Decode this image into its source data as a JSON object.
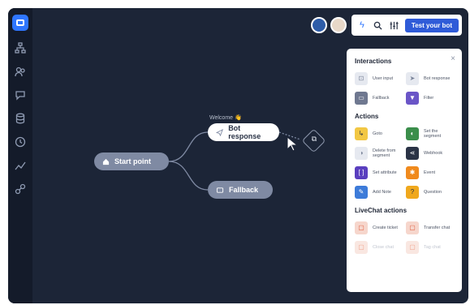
{
  "sidebar": {
    "items": [
      {
        "icon": "chat-bubble-icon"
      },
      {
        "icon": "flow-tree-icon"
      },
      {
        "icon": "users-icon"
      },
      {
        "icon": "message-icon"
      },
      {
        "icon": "database-icon"
      },
      {
        "icon": "clock-icon"
      },
      {
        "icon": "analytics-icon"
      },
      {
        "icon": "integrations-icon"
      }
    ]
  },
  "flow": {
    "start_label": "Start point",
    "welcome_label": "Welcome 👋",
    "bot_label": "Bot response",
    "fallback_label": "Fallback"
  },
  "topbar": {
    "test_button_label": "Test your bot"
  },
  "panel": {
    "close": "×",
    "interactions": {
      "title": "Interactions",
      "items": [
        {
          "label": "User input",
          "color": "#e6e9f0",
          "icon": "user-input-icon"
        },
        {
          "label": "Bot response",
          "color": "#e6e9f0",
          "icon": "send-icon"
        },
        {
          "label": "Fallback",
          "color": "#6f7890",
          "icon": "fallback-icon"
        },
        {
          "label": "Filter",
          "color": "#6a55c7",
          "icon": "filter-icon"
        }
      ]
    },
    "actions": {
      "title": "Actions",
      "items": [
        {
          "label": "Goto",
          "color": "#f2c744",
          "icon": "goto-icon"
        },
        {
          "label": "Set the segment",
          "color": "#3b8e4b",
          "icon": "segment-icon"
        },
        {
          "label": "Delete from segment",
          "color": "#e6e9f0",
          "icon": "delete-segment-icon"
        },
        {
          "label": "Webhook",
          "color": "#2a3346",
          "icon": "webhook-icon"
        },
        {
          "label": "Set attribute",
          "color": "#5a3fbf",
          "icon": "attribute-icon"
        },
        {
          "label": "Event",
          "color": "#f08a1d",
          "icon": "event-icon"
        },
        {
          "label": "Add Note",
          "color": "#3d7bd9",
          "icon": "note-icon"
        },
        {
          "label": "Question",
          "color": "#f0a81d",
          "icon": "question-icon"
        }
      ]
    },
    "livechat": {
      "title": "LiveChat actions",
      "items": [
        {
          "label": "Create ticket",
          "color": "#f6d6cc",
          "icon": "ticket-icon"
        },
        {
          "label": "Transfer chat",
          "color": "#f6d6cc",
          "icon": "transfer-icon"
        },
        {
          "label": "Close chat",
          "color": "#f9e7e1",
          "icon": "close-chat-icon"
        },
        {
          "label": "Tag chat",
          "color": "#f9e7e1",
          "icon": "tag-icon"
        }
      ]
    }
  }
}
